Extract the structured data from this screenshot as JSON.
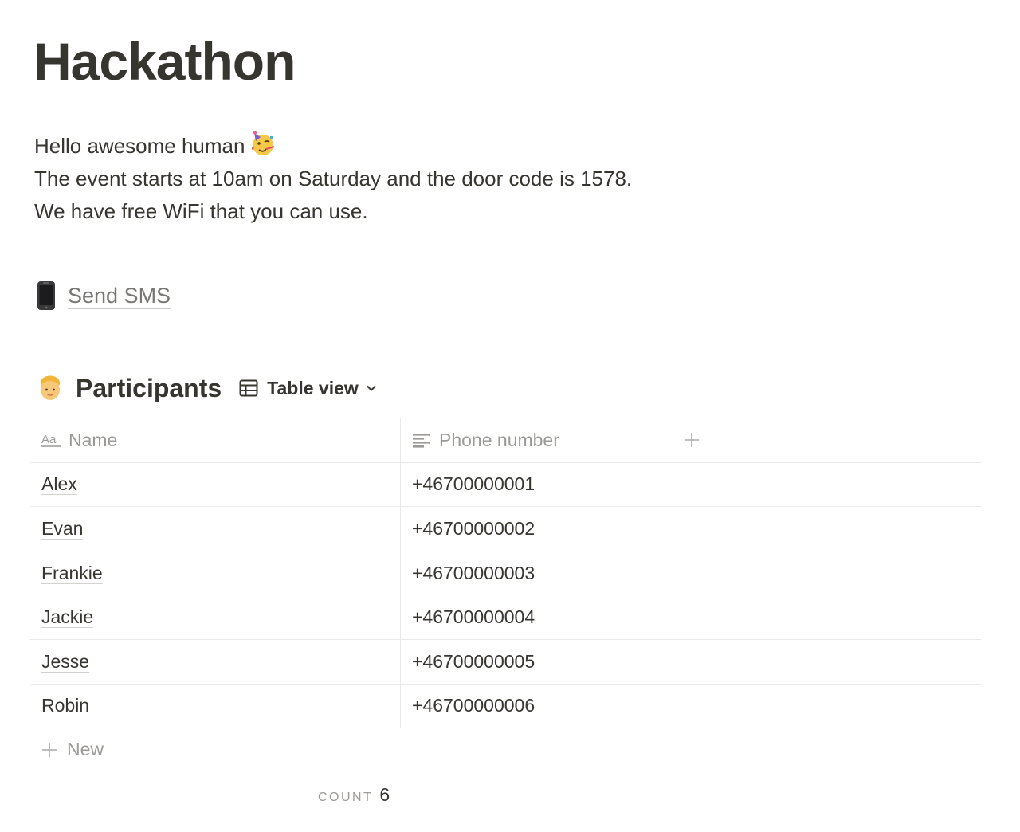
{
  "page": {
    "title": "Hackathon",
    "intro_lines": [
      "Hello awesome human",
      "The event starts at 10am on Saturday and the door code is 1578.",
      "We have free WiFi that you can use."
    ],
    "intro_emoji": "partying-face-icon"
  },
  "sms_link": {
    "icon": "mobile-phone-icon",
    "label": "Send SMS"
  },
  "database": {
    "icon": "person-icon",
    "title": "Participants",
    "view_label": "Table view",
    "columns": {
      "name": "Name",
      "phone": "Phone number"
    },
    "rows": [
      {
        "name": "Alex",
        "phone": "+46700000001"
      },
      {
        "name": "Evan",
        "phone": "+46700000002"
      },
      {
        "name": "Frankie",
        "phone": "+46700000003"
      },
      {
        "name": "Jackie",
        "phone": "+46700000004"
      },
      {
        "name": "Jesse",
        "phone": "+46700000005"
      },
      {
        "name": "Robin",
        "phone": "+46700000006"
      }
    ],
    "new_label": "New",
    "count_label": "COUNT",
    "count_value": "6"
  },
  "colors": {
    "text": "#37352f",
    "muted": "#9b9a97",
    "border": "#e9e9e7"
  }
}
